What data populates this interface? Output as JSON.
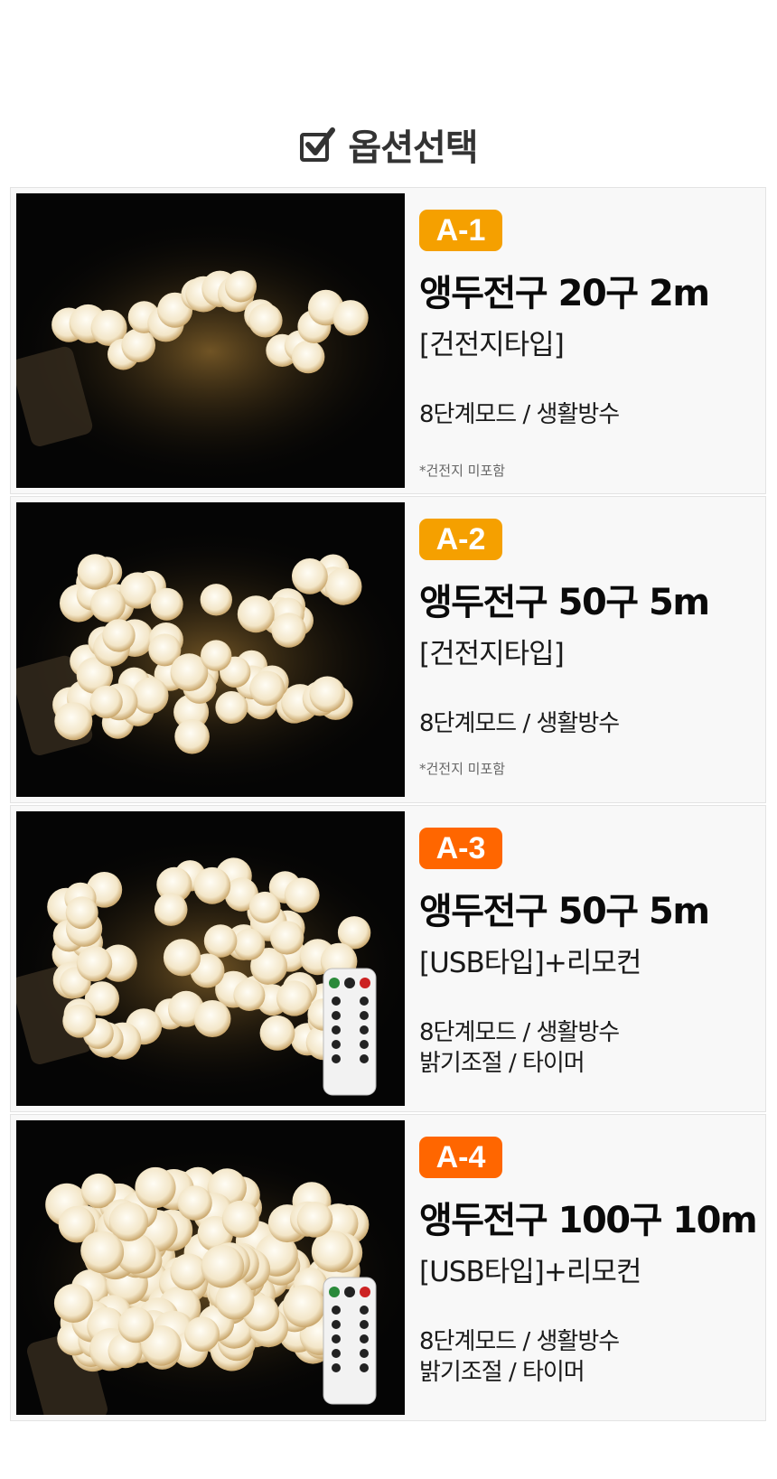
{
  "header": {
    "title": "옵션선택"
  },
  "products": [
    {
      "badge": "A-1",
      "badge_color": "#f5a000",
      "name": "앵두전구 20구 2m",
      "type": "[건전지타입]",
      "features": [
        "8단계모드 / 생활방수"
      ],
      "note": "*건전지 미포함"
    },
    {
      "badge": "A-2",
      "badge_color": "#f5a000",
      "name": "앵두전구 50구 5m",
      "type": "[건전지타입]",
      "features": [
        "8단계모드 / 생활방수"
      ],
      "note": "*건전지 미포함"
    },
    {
      "badge": "A-3",
      "badge_color": "#ff6600",
      "name": "앵두전구 50구 5m",
      "type": "[USB타입]+리모컨",
      "features": [
        "8단계모드 / 생활방수",
        "밝기조절 / 타이머"
      ],
      "note": ""
    },
    {
      "badge": "A-4",
      "badge_color": "#ff6600",
      "name": "앵두전구 100구 10m",
      "type": "[USB타입]+리모컨",
      "features": [
        "8단계모드 / 생활방수",
        "밝기조절 / 타이머"
      ],
      "note": ""
    }
  ]
}
